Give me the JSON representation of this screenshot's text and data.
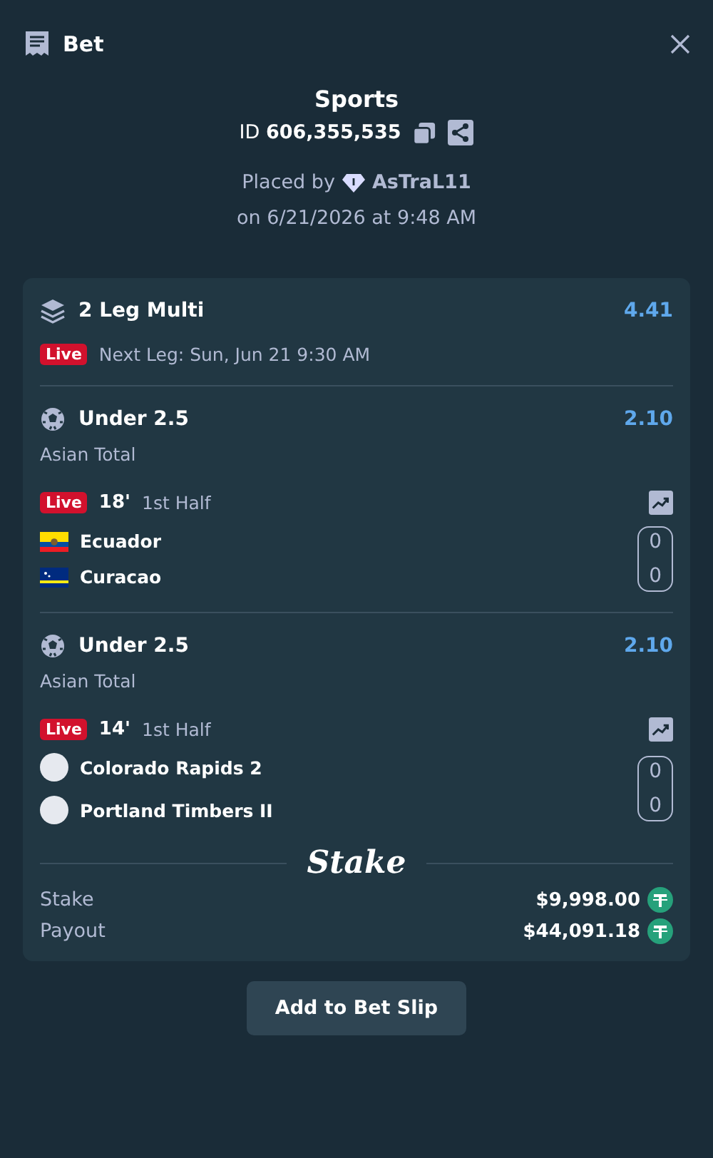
{
  "header": {
    "title": "Bet"
  },
  "summary": {
    "title": "Sports",
    "id_label": "ID",
    "id_value": "606,355,535",
    "placed_by_label": "Placed by",
    "user": "AsTraL11",
    "placed_on": "on 6/21/2026 at 9:48 AM"
  },
  "multi": {
    "title": "2 Leg Multi",
    "odds": "4.41",
    "live": true,
    "live_label": "Live",
    "next_leg": "Next Leg: Sun, Jun 21 9:30 AM"
  },
  "legs": [
    {
      "selection": "Under 2.5",
      "odds": "2.10",
      "market": "Asian Total",
      "live": true,
      "live_label": "Live",
      "minute": "18'",
      "period": "1st Half",
      "teams": [
        {
          "name": "Ecuador",
          "kind": "ecuador",
          "score": "0"
        },
        {
          "name": "Curacao",
          "kind": "curacao",
          "score": "0"
        }
      ]
    },
    {
      "selection": "Under 2.5",
      "odds": "2.10",
      "market": "Asian Total",
      "live": true,
      "live_label": "Live",
      "minute": "14'",
      "period": "1st Half",
      "teams": [
        {
          "name": "Colorado Rapids 2",
          "kind": "plain",
          "score": "0"
        },
        {
          "name": "Portland Timbers II",
          "kind": "plain",
          "score": "0"
        }
      ]
    }
  ],
  "brand": "Stake",
  "totals": [
    {
      "label": "Stake",
      "amount": "$9,998.00"
    },
    {
      "label": "Payout",
      "amount": "$44,091.18"
    }
  ],
  "button": "Add to Bet Slip"
}
